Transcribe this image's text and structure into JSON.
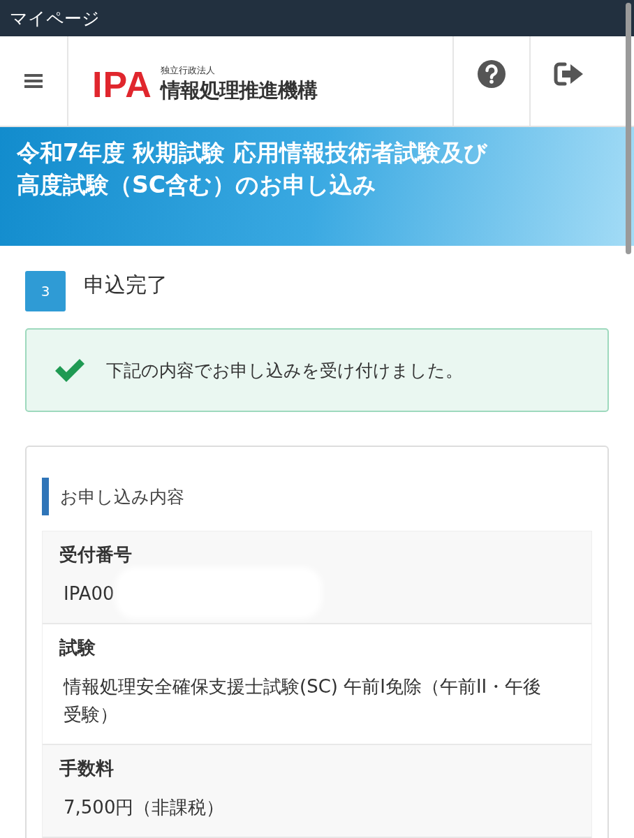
{
  "top_bar": {
    "title": "マイページ"
  },
  "header": {
    "logo": {
      "mark": "IPA",
      "subtitle": "独立行政法人",
      "name": "情報処理推進機構"
    }
  },
  "banner": {
    "title": "令和7年度 秋期試験 応用情報技術者試験及び高度試験（SC含む）のお申し込み"
  },
  "step": {
    "number": "3",
    "label": "申込完了"
  },
  "alert": {
    "message": "下記の内容でお申し込みを受け付けました。"
  },
  "details": {
    "heading": "お申し込み内容",
    "rows": [
      {
        "label": "受付番号",
        "value": "IPA00",
        "redacted": true
      },
      {
        "label": "試験",
        "value": "情報処理安全確保支援士試験(SC) 午前I免除（午前II・午後受験）",
        "redacted": false
      },
      {
        "label": "手数料",
        "value": "7,500円（非課税）",
        "redacted": false
      }
    ]
  }
}
